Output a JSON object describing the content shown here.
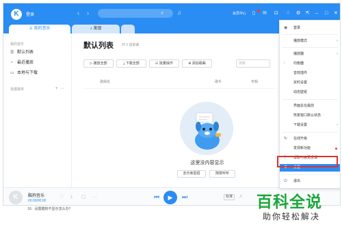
{
  "colors": {
    "accent": "#2a8df3",
    "highlight_border": "#e0302c",
    "badge_red": "#ff3b30",
    "watermark_green": "#1ca63a"
  },
  "titlebar": {
    "logo_letter": "K",
    "login": "登录",
    "member_label": "会员中心"
  },
  "tabs": [
    {
      "label": "我的音乐",
      "icon": "user-icon"
    },
    {
      "label": "发现",
      "icon": "music-note-icon"
    }
  ],
  "sidebar": {
    "section_my_music": "我的音乐",
    "items": [
      {
        "label": "默认列表",
        "icon": "list-icon"
      },
      {
        "label": "最近播放",
        "icon": "clock-icon"
      },
      {
        "label": "本地与下载",
        "icon": "monitor-icon"
      }
    ],
    "section_playlists": "自建歌单"
  },
  "main": {
    "title": "默认列表",
    "count": "共 0 首歌曲",
    "toolbar": [
      {
        "label": "播放全部",
        "icon": "play-icon"
      },
      {
        "label": "下载全部",
        "icon": "download-icon"
      },
      {
        "label": "批量操作",
        "icon": "batch-icon"
      },
      {
        "label": "添加歌曲",
        "icon": "plus-icon"
      }
    ],
    "search_placeholder": "搜索",
    "columns": [
      "歌曲名",
      "歌手",
      "专辑"
    ],
    "empty_text": "这里没内容显示",
    "empty_buttons": [
      "去乐库逛逛",
      "随意听听"
    ]
  },
  "player": {
    "song_title": "酷狗音乐",
    "time": "00:00/00:00",
    "quality": "标准"
  },
  "menu": {
    "items": [
      {
        "label": "登录",
        "icon": "user-circle-icon"
      },
      {
        "label": "播放模式",
        "icon": "",
        "has_arrow": true
      },
      {
        "label": "播放器",
        "icon": "",
        "has_arrow": true
      },
      {
        "label": "均衡器",
        "icon": "equalizer-icon"
      },
      {
        "label": "音效插件",
        "icon": ""
      },
      {
        "label": "定时设置",
        "icon": ""
      },
      {
        "label": "动态壁纸",
        "icon": ""
      },
      {
        "label": "界面总在最前",
        "icon": ""
      },
      {
        "label": "恢复窗口默认状态",
        "icon": ""
      },
      {
        "label": "下载设置",
        "icon": "",
        "has_arrow": true
      },
      {
        "label": "在线升级",
        "icon": "refresh-icon"
      },
      {
        "label": "发现新功能",
        "icon": "",
        "has_dot": true
      },
      {
        "label": "帮助与意见反馈",
        "icon": "help-icon",
        "has_arrow": true
      },
      {
        "label": "设置",
        "icon": "settings-icon",
        "highlighted": true
      },
      {
        "label": "退出",
        "icon": "power-icon"
      }
    ]
  },
  "caption": "16：设置酷狗不显示怎么办？",
  "watermark": {
    "big": "百科全说",
    "small": "助你轻松解决"
  }
}
